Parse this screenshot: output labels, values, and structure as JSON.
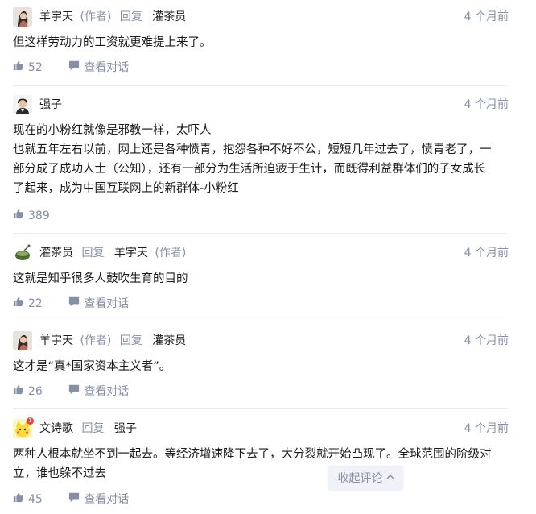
{
  "labels": {
    "author_tag": "(作者)",
    "reply": "回复",
    "view_conversation": "查看对话"
  },
  "comments": [
    {
      "author": "羊宇天",
      "author_is_op": true,
      "reply_to": "灌茶员",
      "reply_to_is_op": false,
      "time": "4 个月前",
      "content": "但这样劳动力的工资就更难提上来了。",
      "likes": "52",
      "has_conversation": true
    },
    {
      "author": "强子",
      "author_is_op": false,
      "reply_to": "",
      "reply_to_is_op": false,
      "time": "4 个月前",
      "content_lines": [
        "现在的小粉红就像是邪教一样，太吓人",
        "也就五年左右以前，网上还是各种愤青，抱怨各种不好不公，短短几年过去了，愤青老了，一",
        "部分成了成功人士（公知），还有一部分为生活所迫疲于生计，而既得利益群体们的子女成长",
        "了起来，成为中国互联网上的新群体-小粉红"
      ],
      "likes": "389",
      "has_conversation": false
    },
    {
      "author": "灌茶员",
      "author_is_op": false,
      "reply_to": "羊宇天",
      "reply_to_is_op": true,
      "time": "4 个月前",
      "content": "这就是知乎很多人鼓吹生育的目的",
      "likes": "22",
      "has_conversation": true
    },
    {
      "author": "羊宇天",
      "author_is_op": true,
      "reply_to": "灌茶员",
      "reply_to_is_op": false,
      "time": "4 个月前",
      "content": "这才是“真*国家资本主义者”。",
      "likes": "26",
      "has_conversation": true
    },
    {
      "author": "文诗歌",
      "author_is_op": false,
      "reply_to": "强子",
      "reply_to_is_op": false,
      "time": "4 个月前",
      "content_lines": [
        "两种人根本就坐不到一起去。等经济增速降下去了，大分裂就开始凸现了。全球范围的阶级对",
        "立，谁也躲不过去"
      ],
      "likes": "45",
      "has_conversation": true,
      "avatar_badge": "1"
    }
  ],
  "collapse_button": {
    "label": "收起评论"
  },
  "colors": {
    "meta_gray": "#8590a6",
    "divider": "#ebebeb",
    "text": "#1a1a1a",
    "button_bg": "#f0f2f7"
  }
}
